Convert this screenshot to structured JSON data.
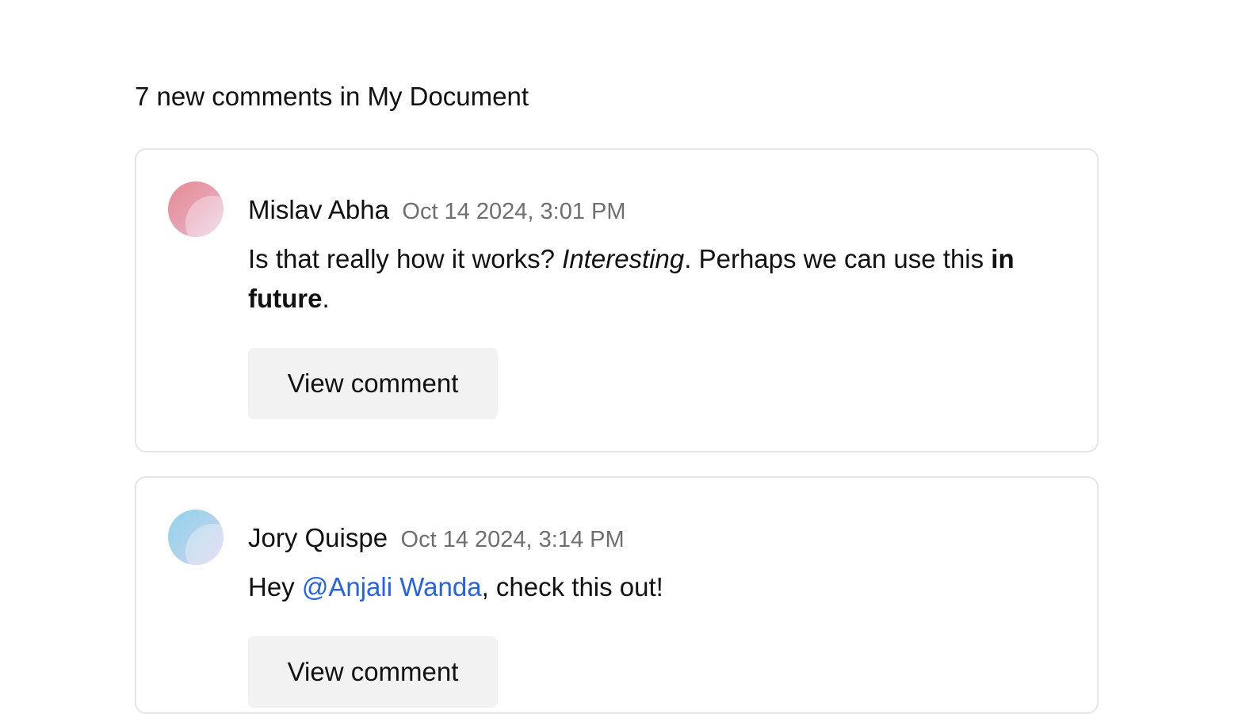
{
  "header": {
    "count_text": "7 new comments",
    "connector": "in",
    "document_name": "My Document"
  },
  "comments": [
    {
      "author": "Mislav Abha",
      "timestamp": "Oct 14 2024, 3:01 PM",
      "avatar_colors": [
        "#e8898f",
        "#e9c8e0"
      ],
      "avatar_icon": "gradient-avatar",
      "body": {
        "part1": "Is that really how it works? ",
        "italic": "Interesting",
        "part2": ". Perhaps we can use this ",
        "bold": "in future",
        "part3": "."
      },
      "button_label": "View comment"
    },
    {
      "author": "Jory Quispe",
      "timestamp": "Oct 14 2024, 3:14 PM",
      "avatar_colors": [
        "#8fd4ec",
        "#d9c8ec"
      ],
      "avatar_icon": "gradient-avatar",
      "body": {
        "part1": "Hey ",
        "mention": "@Anjali Wanda",
        "part2": ", check this out!"
      },
      "button_label": "View comment"
    }
  ],
  "colors": {
    "mention": "#2563eb",
    "timestamp": "#6f6f6f",
    "button_bg": "#f2f2f2",
    "card_border": "#e6e6e6"
  }
}
